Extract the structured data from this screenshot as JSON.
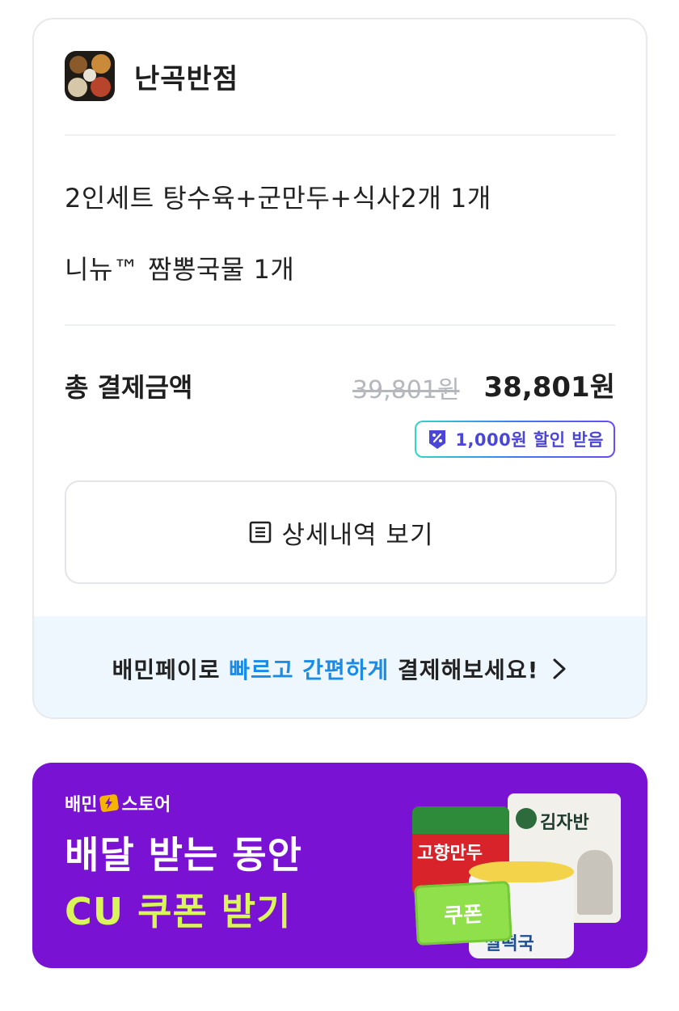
{
  "store": {
    "name": "난곡반점",
    "thumbnail_icon": "food-dishes-photo"
  },
  "menu_items": [
    "2인세트 탕수육+군만두+식사2개 1개",
    "니뉴™ 짬뽕국물 1개"
  ],
  "payment": {
    "total_label": "총 결제금액",
    "original_price": "39,801원",
    "final_price": "38,801원",
    "discount_badge": "1,000원 할인 받음"
  },
  "detail_button": {
    "label": "상세내역 보기",
    "icon": "receipt-icon"
  },
  "pay_banner": {
    "prefix": "배민페이로 ",
    "highlight": "빠르고 간편하게",
    "suffix": " 결제해보세요!",
    "highlight_color": "#1a8ce8"
  },
  "promo": {
    "brand_left": "배민",
    "brand_right": "스토어",
    "title": "배달 받는 동안",
    "subtitle": "CU 쿠폰 받기",
    "coupon_label": "쿠폰",
    "product_labels": [
      "고향만두",
      "김자반",
      "쌀떡국"
    ],
    "background_color": "#7a12d4",
    "accent_color": "#d9f55a"
  }
}
